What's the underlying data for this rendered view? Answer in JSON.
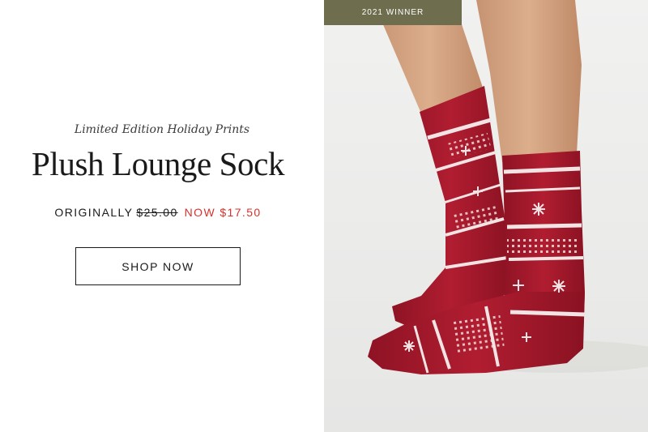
{
  "promo": {
    "subtitle": "Limited Edition Holiday Prints",
    "title": "Plush Lounge Sock",
    "price_prefix": "ORIGINALLY",
    "price_original": "$25.00",
    "price_now": "NOW $17.50",
    "cta_label": "SHOP NOW"
  },
  "badge": {
    "label": "2021 WINNER"
  },
  "colors": {
    "badge_bg": "#6e6e4f",
    "sale_red": "#d8312b",
    "sock_red": "#a5182b",
    "pattern_white": "#f2e4e4"
  },
  "image": {
    "icon": "product-photo-socks"
  }
}
